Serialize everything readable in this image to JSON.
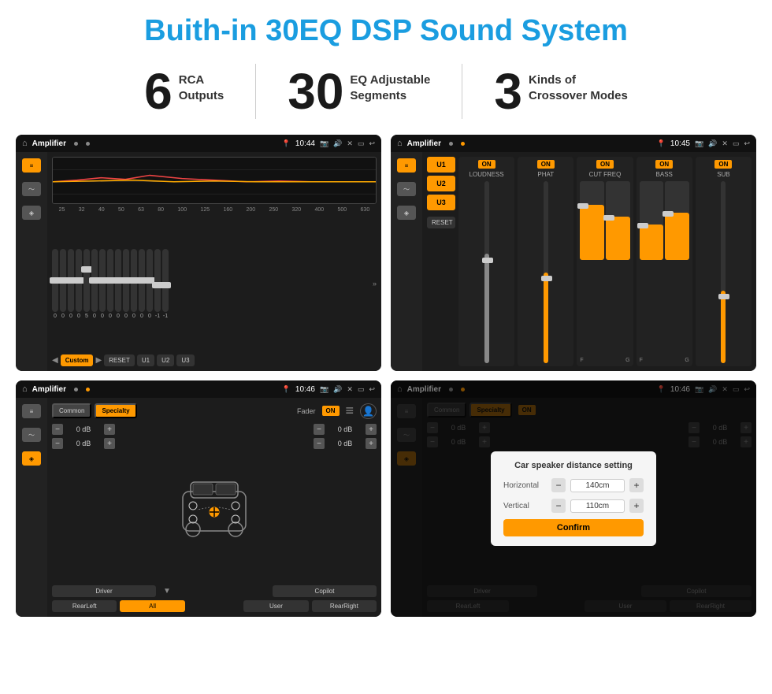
{
  "page": {
    "title": "Buith-in 30EQ DSP Sound System",
    "stats": [
      {
        "number": "6",
        "line1": "RCA",
        "line2": "Outputs"
      },
      {
        "number": "30",
        "line1": "EQ Adjustable",
        "line2": "Segments"
      },
      {
        "number": "3",
        "line1": "Kinds of",
        "line2": "Crossover Modes"
      }
    ]
  },
  "screens": {
    "eq": {
      "title": "Amplifier",
      "time": "10:44",
      "freqs": [
        "25",
        "32",
        "40",
        "50",
        "63",
        "80",
        "100",
        "125",
        "160",
        "200",
        "250",
        "320",
        "400",
        "500",
        "630"
      ],
      "sliders": [
        0,
        0,
        0,
        0,
        5,
        0,
        0,
        0,
        0,
        0,
        0,
        0,
        0,
        -1,
        0,
        -1
      ],
      "buttons": [
        "Custom",
        "RESET",
        "U1",
        "U2",
        "U3"
      ]
    },
    "crossover": {
      "title": "Amplifier",
      "time": "10:45",
      "u_buttons": [
        "U1",
        "U2",
        "U3"
      ],
      "channels": [
        {
          "label": "LOUDNESS",
          "on": true
        },
        {
          "label": "PHAT",
          "on": true
        },
        {
          "label": "CUT FREQ",
          "on": true
        },
        {
          "label": "BASS",
          "on": true
        },
        {
          "label": "SUB",
          "on": true
        }
      ],
      "reset": "RESET"
    },
    "fader": {
      "title": "Amplifier",
      "time": "10:46",
      "tabs": [
        "Common",
        "Specialty"
      ],
      "active_tab": "Specialty",
      "fader_label": "Fader",
      "fader_on": "ON",
      "left_dbs": [
        "0 dB",
        "0 dB"
      ],
      "right_dbs": [
        "0 dB",
        "0 dB"
      ],
      "bottom_btns": [
        "Driver",
        "",
        "",
        "",
        "Copilot",
        "RearLeft",
        "All",
        "",
        "User",
        "RearRight"
      ]
    },
    "dialog": {
      "title": "Amplifier",
      "time": "10:46",
      "dialog_title": "Car speaker distance setting",
      "horizontal_label": "Horizontal",
      "horizontal_value": "140cm",
      "vertical_label": "Vertical",
      "vertical_value": "110cm",
      "confirm_label": "Confirm",
      "left_dbs": [
        "0 dB",
        "0 dB"
      ],
      "right_dbs": [
        "0 dB",
        "0 dB"
      ]
    }
  },
  "icons": {
    "home": "⌂",
    "location": "📍",
    "speaker": "🔊",
    "back": "↩",
    "equalizer": "⚙",
    "waveform": "〜",
    "expand": "»"
  }
}
